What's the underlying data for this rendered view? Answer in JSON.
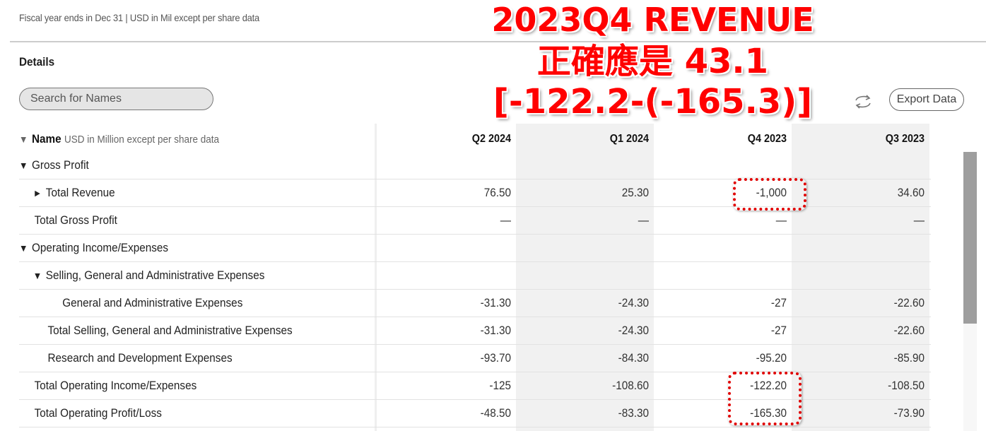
{
  "header": {
    "fiscal_note": "Fiscal year ends in Dec 31 | USD in Mil except per share data",
    "details_title": "Details"
  },
  "search": {
    "placeholder": "Search for Names",
    "value": ""
  },
  "toolbar": {
    "refresh_icon": "refresh-arrows-icon",
    "export_label": "Export Data"
  },
  "table": {
    "name_header": {
      "toggle_icon": "▼",
      "label": "Name",
      "sublabel": "USD in Million except per share data"
    },
    "columns": [
      "Q2 2024",
      "Q1 2024",
      "Q4 2023",
      "Q3 2023"
    ],
    "rows": [
      {
        "name": "Gross Profit",
        "toggle": "▼",
        "values": [
          "",
          "",
          "",
          ""
        ]
      },
      {
        "name": "Total Revenue",
        "toggle": "►",
        "values": [
          "76.50",
          "25.30",
          "-1,000",
          "34.60"
        ]
      },
      {
        "name": "Total Gross Profit",
        "toggle": "",
        "values": [
          "—",
          "—",
          "—",
          "—"
        ]
      },
      {
        "name": "Operating Income/Expenses",
        "toggle": "▼",
        "values": [
          "",
          "",
          "",
          ""
        ]
      },
      {
        "name": "Selling, General and Administrative Expenses",
        "toggle": "▼",
        "values": [
          "",
          "",
          "",
          ""
        ]
      },
      {
        "name": "General and Administrative Expenses",
        "toggle": "",
        "values": [
          "-31.30",
          "-24.30",
          "-27",
          "-22.60"
        ]
      },
      {
        "name": "Total Selling, General and Administrative Expenses",
        "toggle": "",
        "values": [
          "-31.30",
          "-24.30",
          "-27",
          "-22.60"
        ]
      },
      {
        "name": "Research and Development Expenses",
        "toggle": "",
        "values": [
          "-93.70",
          "-84.30",
          "-95.20",
          "-85.90"
        ]
      },
      {
        "name": "Total Operating Income/Expenses",
        "toggle": "",
        "values": [
          "-125",
          "-108.60",
          "-122.20",
          "-108.50"
        ]
      },
      {
        "name": "Total Operating Profit/Loss",
        "toggle": "",
        "values": [
          "-48.50",
          "-83.30",
          "-165.30",
          "-73.90"
        ]
      }
    ]
  },
  "annotation": {
    "line1": "2023Q4 REVENUE",
    "line2": "正確應是 43.1",
    "line3": "[-122.2-(-165.3)]",
    "color": "#ff0000"
  }
}
